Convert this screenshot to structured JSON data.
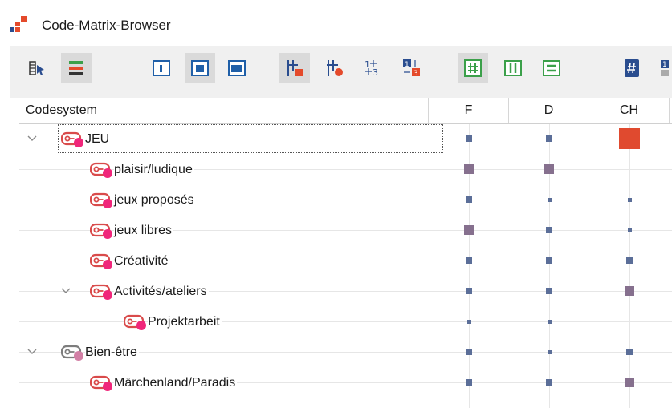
{
  "window": {
    "title": "Code-Matrix-Browser"
  },
  "colors": {
    "accent": "#e44a2b",
    "code_red": "#d94b4b",
    "code_pink": "#f0267a",
    "code_gray": "#7d7d7d",
    "mauve": "#d27fa5",
    "symbol_small": "#5b6e98",
    "symbol_medium": "#86708e",
    "symbol_large": "#e04a2f"
  },
  "toolbar": {
    "buttons": [
      {
        "name": "select-codes-button",
        "icon": "select-codes-icon",
        "pressed": false
      },
      {
        "name": "activate-colors-button",
        "icon": "color-bars-icon",
        "pressed": true
      },
      {
        "name": "view-single-button",
        "icon": "layout-single-icon",
        "pressed": false
      },
      {
        "name": "view-center-button",
        "icon": "layout-center-icon",
        "pressed": true
      },
      {
        "name": "view-wide-button",
        "icon": "layout-wide-icon",
        "pressed": false
      },
      {
        "name": "symbols-squares-button",
        "icon": "matrix-squares-icon",
        "pressed": true
      },
      {
        "name": "symbols-circles-button",
        "icon": "matrix-circles-icon",
        "pressed": false
      },
      {
        "name": "symbols-numbers-button",
        "icon": "matrix-numbers-icon",
        "pressed": false
      },
      {
        "name": "symbols-colored-numbers-button",
        "icon": "matrix-colored-numbers-icon",
        "pressed": false
      },
      {
        "name": "count-hits-button",
        "icon": "hash-grid-icon",
        "pressed": true
      },
      {
        "name": "columns-button",
        "icon": "columns-icon",
        "pressed": false
      },
      {
        "name": "rows-button",
        "icon": "rows-icon",
        "pressed": false
      },
      {
        "name": "number-button",
        "icon": "hash-icon",
        "pressed": false
      },
      {
        "name": "more-button",
        "icon": "more-icon",
        "pressed": false
      }
    ]
  },
  "table": {
    "header": {
      "codesystem": "Codesystem",
      "columns": [
        "F",
        "D",
        "CH"
      ]
    },
    "rows": [
      {
        "label": "JEU",
        "level": 0,
        "expanded": true,
        "icon_color": "#f0267a",
        "icon_outline": "#d94b4b",
        "cells": [
          2,
          2,
          4
        ],
        "focused": true
      },
      {
        "label": "plaisir/ludique",
        "level": 1,
        "expanded": null,
        "icon_color": "#f0267a",
        "icon_outline": "#d94b4b",
        "cells": [
          3,
          3,
          0
        ]
      },
      {
        "label": "jeux proposés",
        "level": 1,
        "expanded": null,
        "icon_color": "#f0267a",
        "icon_outline": "#d94b4b",
        "cells": [
          2,
          1,
          1
        ]
      },
      {
        "label": "jeux libres",
        "level": 1,
        "expanded": null,
        "icon_color": "#f0267a",
        "icon_outline": "#d94b4b",
        "cells": [
          3,
          2,
          1
        ]
      },
      {
        "label": "Créativité",
        "level": 1,
        "expanded": null,
        "icon_color": "#f0267a",
        "icon_outline": "#d94b4b",
        "cells": [
          2,
          2,
          2
        ]
      },
      {
        "label": "Activités/ateliers",
        "level": 1,
        "expanded": true,
        "icon_color": "#f0267a",
        "icon_outline": "#d94b4b",
        "cells": [
          2,
          2,
          3
        ]
      },
      {
        "label": "Projektarbeit",
        "level": 2,
        "expanded": null,
        "icon_color": "#f0267a",
        "icon_outline": "#d94b4b",
        "cells": [
          1,
          1,
          0
        ]
      },
      {
        "label": "Bien-être",
        "level": 0,
        "expanded": true,
        "icon_color": "#d27fa5",
        "icon_outline": "#7d7d7d",
        "cells": [
          2,
          1,
          2
        ]
      },
      {
        "label": "Märchenland/Paradis",
        "level": 1,
        "expanded": null,
        "icon_color": "#f0267a",
        "icon_outline": "#d94b4b",
        "cells": [
          2,
          2,
          3
        ]
      }
    ]
  }
}
